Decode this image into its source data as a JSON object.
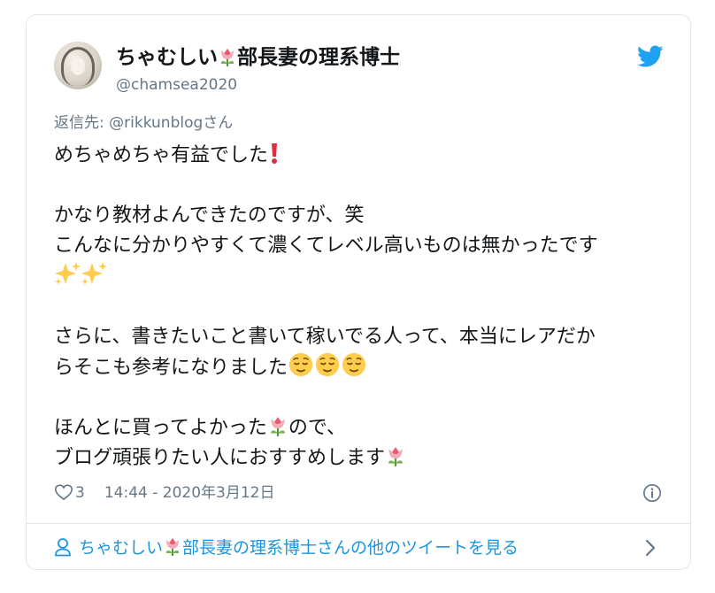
{
  "tweet": {
    "author_name_pre": "ちゃむしい",
    "author_name_post": "部長妻の理系博士",
    "handle": "@chamsea2020",
    "reply_prefix": "返信先: ",
    "reply_to": "@rikkunblog",
    "reply_suffix": "さん",
    "lines": {
      "l1": "めちゃめちゃ有益でした",
      "l2": "かなり教材よんできたのですが、笑",
      "l3": "こんなに分かりやすくて濃くてレベル高いものは無かったです",
      "l5": "さらに、書きたいこと書いて稼いでる人って、本当にレアだか",
      "l6": "らそこも参考になりました",
      "l7a": "ほんとに買ってよかった",
      "l7b": "ので、",
      "l8": "ブログ頑張りたい人におすすめします"
    },
    "like_count": "3",
    "timestamp": "14:44 - 2020年3月12日"
  },
  "footer": {
    "more_pre": "ちゃむしい",
    "more_post": "部長妻の理系博士さんの他のツイートを見る"
  },
  "icons": {
    "brand": "twitter-bird-icon",
    "like": "heart-icon",
    "info": "info-icon",
    "person": "person-icon",
    "chevron": "chevron-right-icon",
    "emoji_tulip": "tulip-emoji",
    "emoji_exclaim": "red-exclamation-emoji",
    "emoji_sparkles": "sparkles-emoji",
    "emoji_relieved": "relieved-face-emoji"
  },
  "colors": {
    "accent": "#1b95e0",
    "text": "#14171a",
    "muted": "#657786",
    "border": "#e1e8ed"
  }
}
